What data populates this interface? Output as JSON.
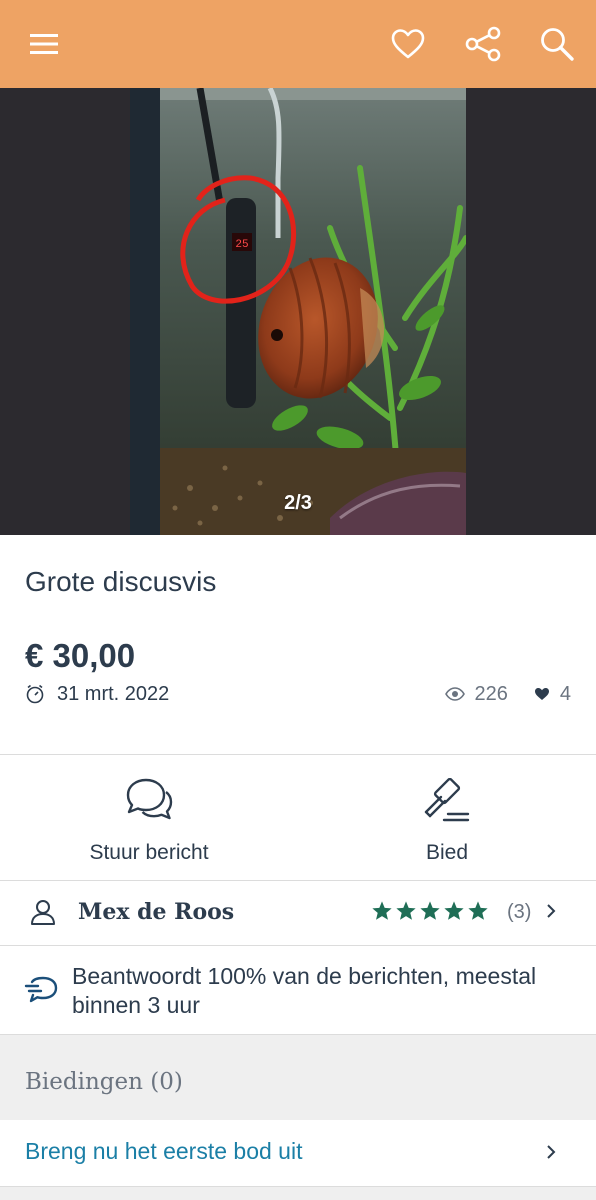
{
  "header": {
    "menu_icon": "hamburger-menu-icon",
    "favorite_icon": "heart-outline-icon",
    "share_icon": "share-icon",
    "search_icon": "magnifier-icon",
    "background_color": "#eea364"
  },
  "gallery": {
    "counter": "2/3",
    "photo_subject": "discus fish in aquarium with heater",
    "heater_display": "25"
  },
  "listing": {
    "title": "Grote discusvis",
    "price": "€ 30,00",
    "date": "31 mrt. 2022",
    "views": "226",
    "favorites": "4"
  },
  "actions": {
    "message_label": "Stuur bericht",
    "bid_label": "Bied"
  },
  "seller": {
    "name": "Mex de Roos",
    "rating_stars": 5,
    "review_count": "(3)",
    "star_color": "#1f6e56"
  },
  "response": {
    "text": "Beantwoordt 100% van de berichten, meestal binnen 3 uur"
  },
  "bids": {
    "heading": "Biedingen (0)",
    "first_bid_link": "Breng nu het eerste bod uit",
    "link_color": "#1b7fa6"
  }
}
